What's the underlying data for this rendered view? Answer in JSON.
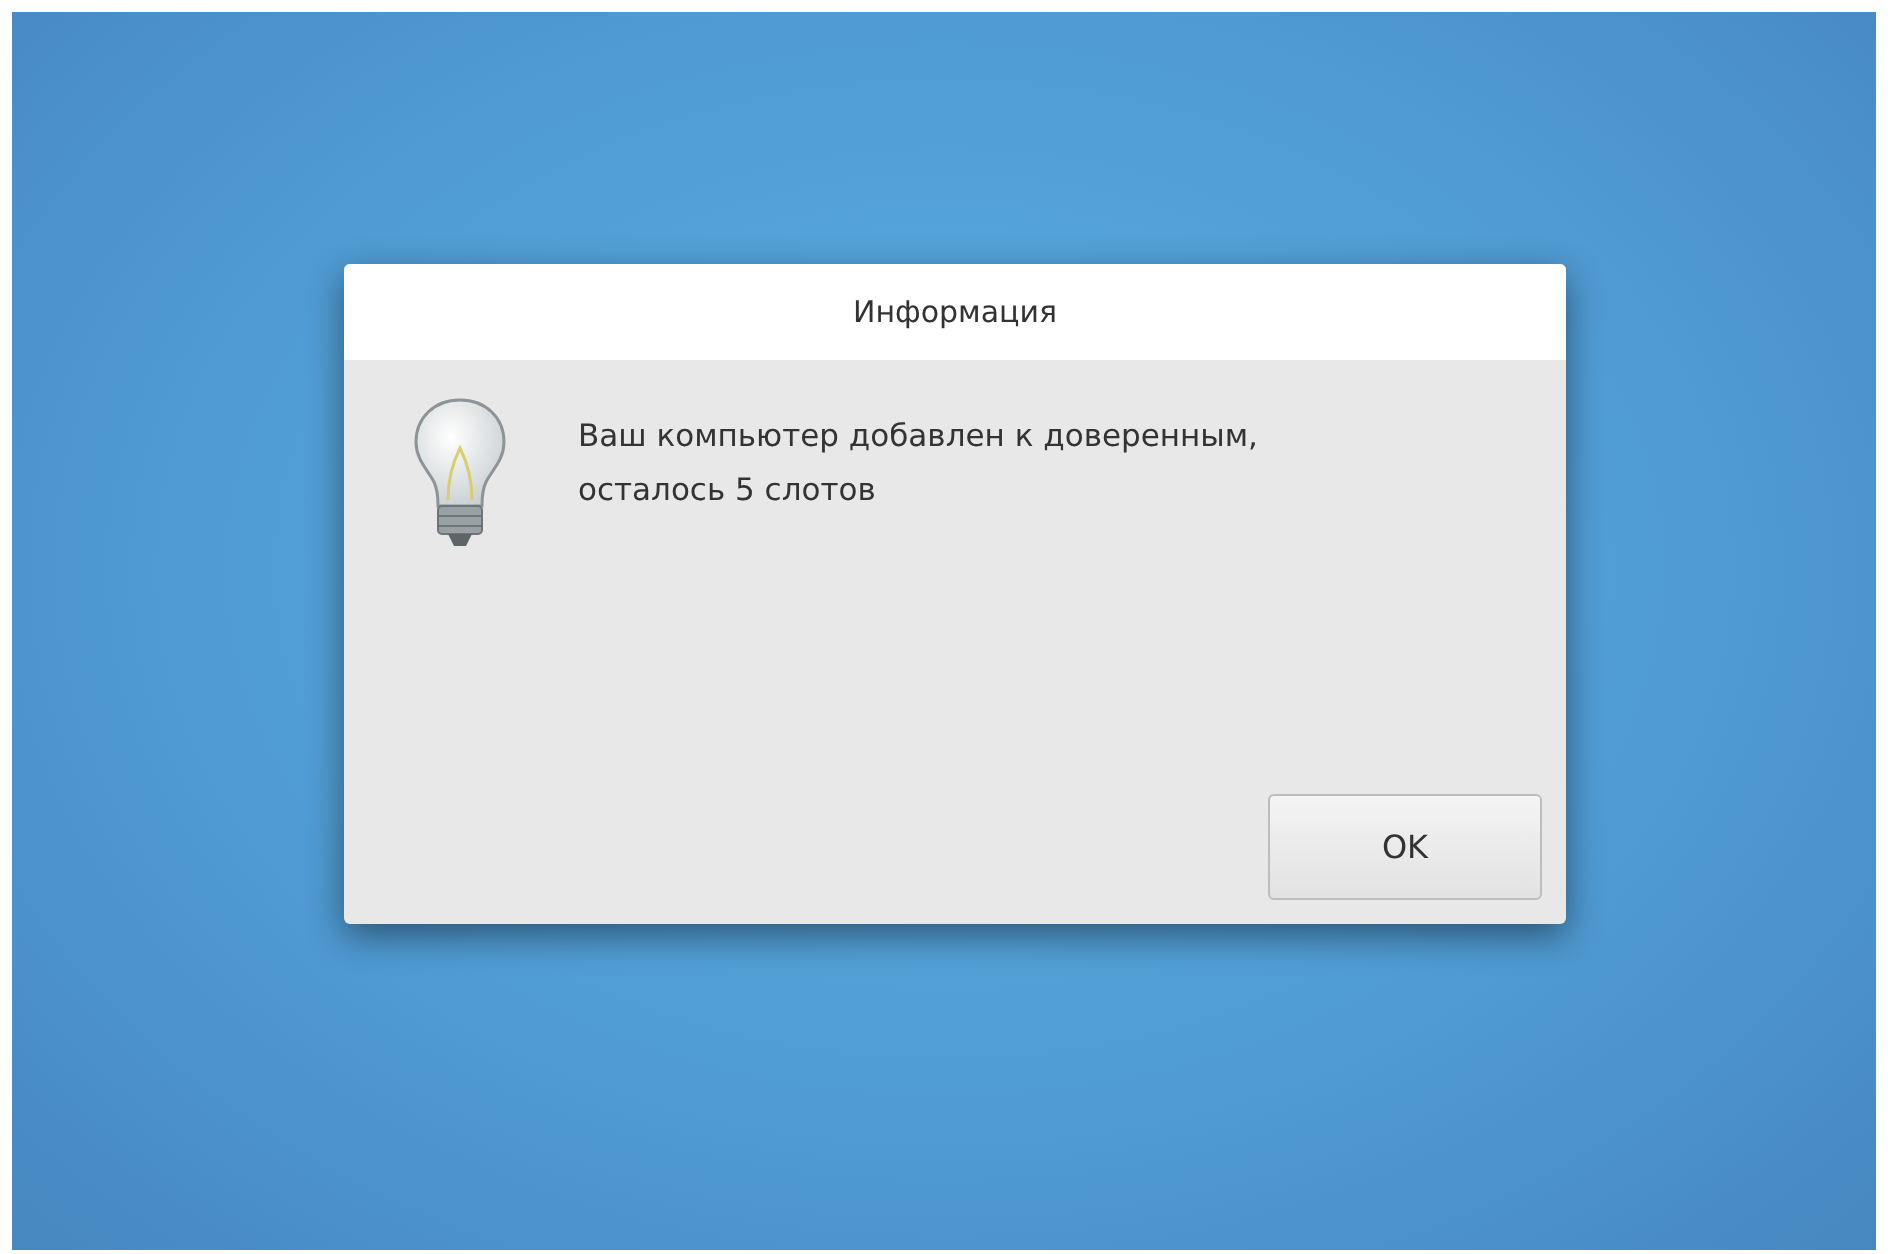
{
  "dialog": {
    "title": "Информация",
    "message_lines": [
      "Ваш компьютер добавлен к доверенным,",
      "осталось 5 слотов"
    ],
    "buttons": [
      "OK"
    ]
  }
}
